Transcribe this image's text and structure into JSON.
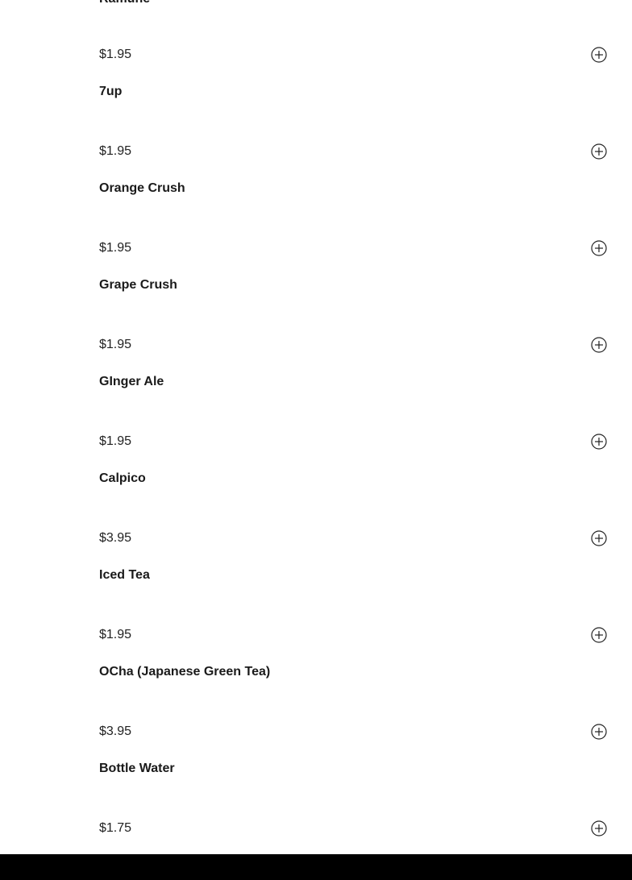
{
  "partial_item_name": "Ramune",
  "items": [
    {
      "price": "$1.95",
      "name": "7up"
    },
    {
      "price": "$1.95",
      "name": "Orange Crush"
    },
    {
      "price": "$1.95",
      "name": "Grape Crush"
    },
    {
      "price": "$1.95",
      "name": "GInger Ale"
    },
    {
      "price": "$1.95",
      "name": "Calpico"
    },
    {
      "price": "$3.95",
      "name": "Iced Tea"
    },
    {
      "price": "$1.95",
      "name": "OCha (Japanese Green Tea)"
    },
    {
      "price": "$3.95",
      "name": "Bottle Water"
    },
    {
      "price": "$1.75",
      "name": ""
    }
  ],
  "icons": {
    "add": "plus-circle-icon"
  }
}
